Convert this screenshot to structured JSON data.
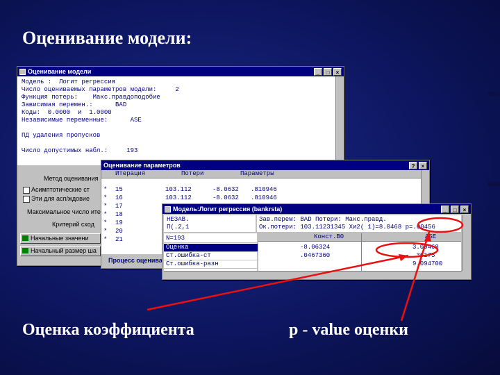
{
  "slide": {
    "title": "Оценивание модели:",
    "caption_left": "Оценка коэффициента",
    "caption_right": "p - value оценки",
    "accent_red": "#e81010",
    "bg": "#0d1660"
  },
  "win1": {
    "title": "Оценивание модели",
    "lines": [
      "Модель :  Логит регрессия",
      "Число оцениваемых параметров модели:     2",
      "Функция потерь:    Макс.правдоподобие",
      "Зависимая перемен.:      BAD",
      "Коды:  0.0000  и  1.0000",
      "Независимые переменные:      ASE",
      "",
      "ПД удаления пропусков",
      "",
      "Число допустимых набл.:     193"
    ],
    "method_label": "Метод оценивания",
    "check1": "Асимптотические ст",
    "check2": "Эти для асп/ждовие",
    "max_label": "Максимальное число ите",
    "criteria_label": "Критерий сход",
    "btn_start": "Начальные значени",
    "btn_step": "Начальный размер ша"
  },
  "win2": {
    "title": "Оценивание параметров",
    "col_iter": "Итерация",
    "col_loss": "Потери",
    "col_params": "Параметры",
    "rows": [
      {
        "mark": "*",
        "iter": "15",
        "loss": "103.112",
        "p1": "-8.0632",
        "p2": ".810946"
      },
      {
        "mark": "*",
        "iter": "16",
        "loss": "103.112",
        "p1": "-8.0632",
        "p2": ".810946"
      },
      {
        "mark": "*",
        "iter": "17",
        "loss": "",
        "p1": "",
        "p2": ""
      },
      {
        "mark": "*",
        "iter": "18",
        "loss": "",
        "p1": "",
        "p2": ""
      },
      {
        "mark": "*",
        "iter": "19",
        "loss": "",
        "p1": "",
        "p2": ""
      },
      {
        "mark": "*",
        "iter": "20",
        "loss": "",
        "p1": "",
        "p2": ""
      },
      {
        "mark": "*",
        "iter": "21",
        "loss": "",
        "p1": "",
        "p2": ""
      }
    ],
    "status": "Процесс оцениван"
  },
  "win3": {
    "title": "Модель:Логит регрессия (bankrsta)",
    "info_left1": "НЕЗАВ.",
    "info_left2": "П(.2,1",
    "info_line1": "Зав.перем: BAD Потери: Макс.правд.",
    "info_line2": "Ок.потери: 103.11231345 Хи2( 1)=8.0468 p=.00456",
    "n_label": "N=193",
    "col_b0": "Конст.B0",
    "col_ase": "ASE",
    "list": [
      "Оценка",
      "Ст.ошибка-ст",
      "Ст.ошибка-разн"
    ],
    "b0_values": [
      "-8.06324",
      ".0467360",
      ""
    ],
    "ase_values": [
      "3.09468",
      ".36175",
      "9.094700"
    ]
  }
}
